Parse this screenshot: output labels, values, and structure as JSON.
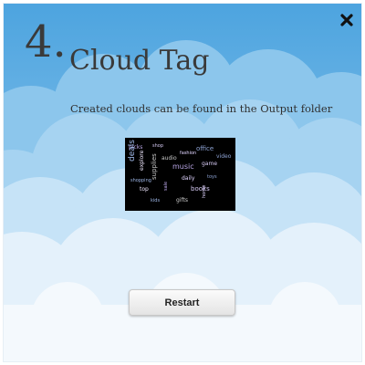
{
  "colors": {
    "sky_top": "#4fa6e0",
    "sky_bottom": "#a9d4f1",
    "cloud_light": "#e9f3fb",
    "cloud_white": "#f7fbfe",
    "title_text": "#3a3a3a"
  },
  "header": {
    "step_number": "4.",
    "title": "Cloud Tag",
    "close_icon": "close-icon"
  },
  "main": {
    "message": "Created clouds can be found in the Output folder",
    "preview_image": "word-cloud-thumbnail",
    "preview_words": [
      "picks",
      "shop",
      "deals",
      "audio",
      "fashion",
      "office",
      "explore",
      "music",
      "game",
      "shopping",
      "supplies",
      "daily",
      "toys",
      "top",
      "sale",
      "books",
      "kids",
      "gifts",
      "home",
      "video"
    ],
    "restart_label": "Restart"
  }
}
